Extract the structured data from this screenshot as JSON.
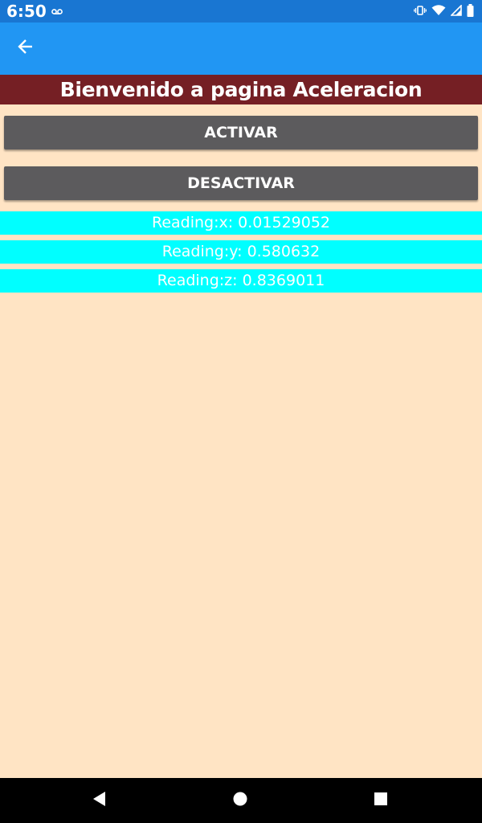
{
  "status_bar": {
    "time": "6:50",
    "icons": [
      "voicemail-icon",
      "vibrate-icon",
      "wifi-icon",
      "signal-icon",
      "battery-icon"
    ]
  },
  "app_bar": {
    "back_icon": "arrow-back-icon",
    "color": "#2196F3"
  },
  "page": {
    "title": "Bienvenido a pagina Aceleracion",
    "title_bg": "#751F24",
    "background": "#FFE4C4"
  },
  "buttons": {
    "activar": "ACTIVAR",
    "desactivar": "DESACTIVAR"
  },
  "readings": {
    "x": "Reading:x: 0.01529052",
    "y": "Reading:y: 0.580632",
    "z": "Reading:z: 0.8369011",
    "bg": "#00FFFF"
  },
  "nav_bar": {
    "icons": [
      "nav-back-icon",
      "nav-home-icon",
      "nav-recents-icon"
    ]
  }
}
